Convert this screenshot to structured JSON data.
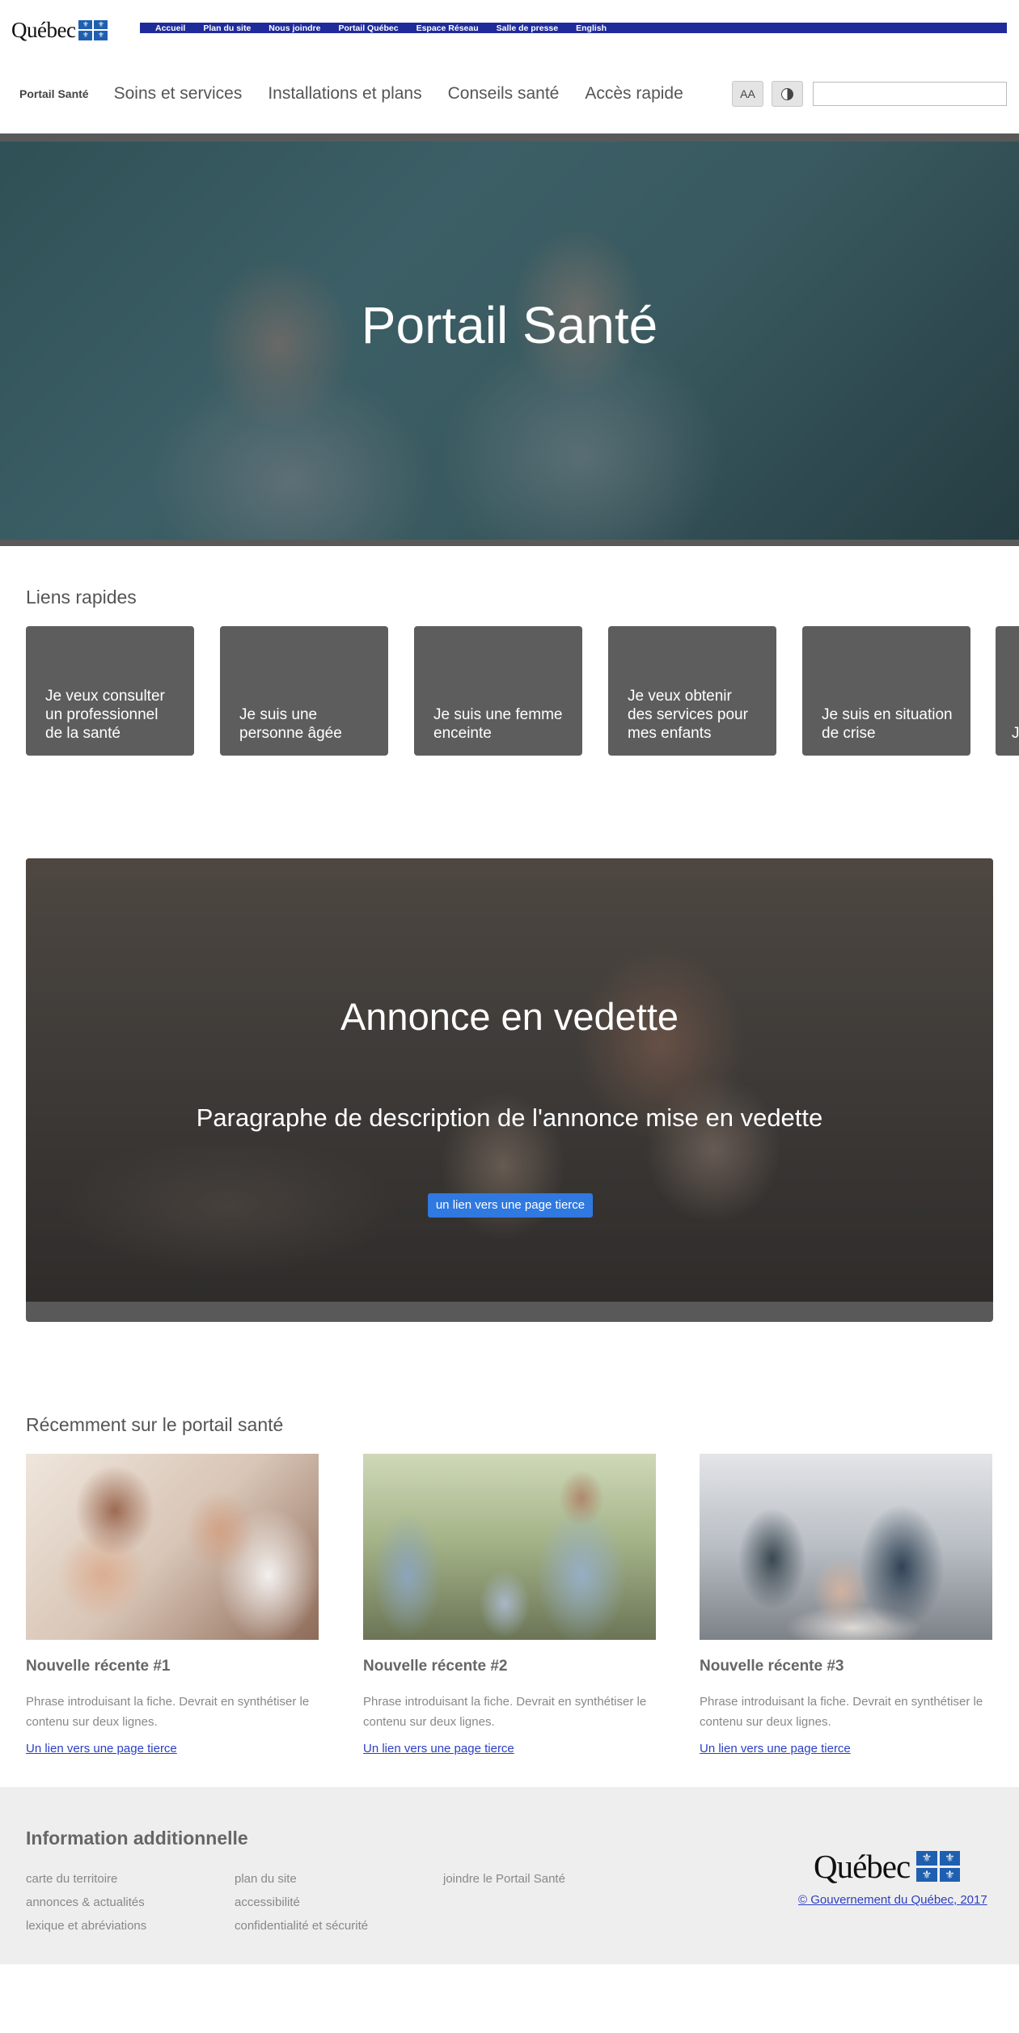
{
  "gov": {
    "wordmark": "Québec",
    "links": [
      "Accueil",
      "Plan du site",
      "Nous joindre",
      "Portail Québec",
      "Espace Réseau",
      "Salle de presse",
      "English"
    ]
  },
  "nav": {
    "brand": "Portail Santé",
    "items": [
      "Soins et services",
      "Installations et plans",
      "Conseils santé",
      "Accès rapide"
    ],
    "text_size_label": "AA",
    "search_value": ""
  },
  "hero": {
    "title": "Portail Santé"
  },
  "quick_links": {
    "title": "Liens rapides",
    "cards": [
      "Je veux consulter un professionnel de la santé",
      "Je suis une personne âgée",
      "Je suis une femme enceinte",
      "Je veux obtenir des services pour mes enfants",
      "Je suis en situation de crise",
      "J"
    ]
  },
  "featured": {
    "title": "Annonce en vedette",
    "description": "Paragraphe de description de l'annonce mise en vedette",
    "link": "un lien vers une page tierce"
  },
  "recent": {
    "title": "Récemment sur le portail santé",
    "items": [
      {
        "title": "Nouvelle récente #1",
        "text": "Phrase introduisant la fiche. Devrait en synthétiser le contenu sur deux lignes.",
        "link": "Un lien vers une page tierce"
      },
      {
        "title": "Nouvelle récente #2",
        "text": "Phrase introduisant la fiche. Devrait en synthétiser le contenu sur deux lignes.",
        "link": "Un lien vers une page tierce"
      },
      {
        "title": "Nouvelle récente #3",
        "text": "Phrase introduisant la fiche. Devrait en synthétiser le contenu sur deux lignes.",
        "link": "Un lien vers une page tierce"
      }
    ]
  },
  "footer": {
    "title": "Information additionnelle",
    "col1": [
      "carte du territoire",
      "annonces & actualités",
      "lexique et abréviations"
    ],
    "col2": [
      "plan du site",
      "accessibilité",
      "confidentialité et sécurité"
    ],
    "col3": [
      "joindre le Portail Santé"
    ],
    "wordmark": "Québec",
    "copyright": "© Gouvernement du Québec, 2017"
  },
  "colors": {
    "gov_bar": "#1f2b9a",
    "link": "#2a3fc4",
    "card": "#5d5d5d",
    "button": "#2f79e0",
    "footer_bg": "#eeeeee"
  },
  "icons": {
    "flag": "fleur-de-lis-flag-icon",
    "contrast": "contrast-icon"
  }
}
